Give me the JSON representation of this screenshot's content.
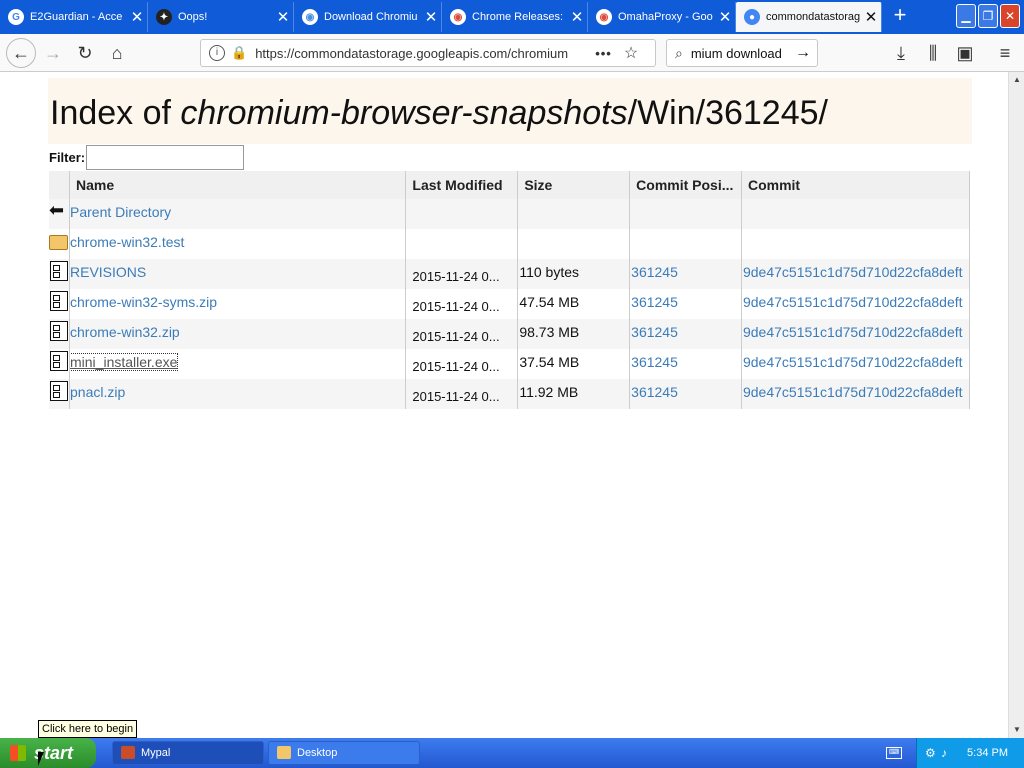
{
  "browser": {
    "tabs": [
      {
        "title": "E2Guardian - Acce",
        "icon": "google-g-icon",
        "color": "#4285f4"
      },
      {
        "title": "Oops!",
        "icon": "sparkle-icon",
        "color": "#222222"
      },
      {
        "title": "Download Chromiu",
        "icon": "chromium-icon",
        "color": "#4a90e2"
      },
      {
        "title": "Chrome Releases:",
        "icon": "chrome-icon",
        "color": "#e04a3a"
      },
      {
        "title": "OmahaProxy - Goo",
        "icon": "chrome-icon",
        "color": "#e04a3a"
      },
      {
        "title": "commondatastorag",
        "icon": "storage-icon",
        "color": "#4285f4",
        "active": true
      }
    ],
    "url": "https://commondatastorage.googleapis.com/chromium",
    "search_value": "mium download"
  },
  "page": {
    "heading_prefix": "Index of ",
    "heading_italic": "chromium-browser-snapshots",
    "heading_suffix": "/Win/361245/",
    "filter_label": "Filter:",
    "filter_value": "",
    "columns": [
      "Name",
      "Last Modified",
      "Size",
      "Commit Posi...",
      "Commit"
    ],
    "rows": [
      {
        "icon": "back",
        "name": "Parent Directory",
        "modified": "",
        "size": "",
        "position": "",
        "commit": ""
      },
      {
        "icon": "folder",
        "name": "chrome-win32.test",
        "modified": "",
        "size": "",
        "position": "",
        "commit": ""
      },
      {
        "icon": "file",
        "name": "REVISIONS",
        "modified": "2015-11-24 0...",
        "size": "110 bytes",
        "position": "361245",
        "commit": "9de47c5151c1d75d710d22cfa8deft"
      },
      {
        "icon": "file",
        "name": "chrome-win32-syms.zip",
        "modified": "2015-11-24 0...",
        "size": "47.54 MB",
        "position": "361245",
        "commit": "9de47c5151c1d75d710d22cfa8deft"
      },
      {
        "icon": "file",
        "name": "chrome-win32.zip",
        "modified": "2015-11-24 0...",
        "size": "98.73 MB",
        "position": "361245",
        "commit": "9de47c5151c1d75d710d22cfa8deft"
      },
      {
        "icon": "file",
        "name": "mini_installer.exe",
        "modified": "2015-11-24 0...",
        "size": "37.54 MB",
        "position": "361245",
        "commit": "9de47c5151c1d75d710d22cfa8deft"
      },
      {
        "icon": "file",
        "name": "pnacl.zip",
        "modified": "2015-11-24 0...",
        "size": "11.92 MB",
        "position": "361245",
        "commit": "9de47c5151c1d75d710d22cfa8deft"
      }
    ]
  },
  "taskbar": {
    "start_label": "start",
    "tooltip": "Click here to begin",
    "buttons": [
      "Mypal",
      "Desktop"
    ],
    "clock": "5:34 PM"
  },
  "colors": {
    "link": "#3b7cb8",
    "tabbar": "#0f5bd8",
    "heading_bg": "#fdf6ec"
  }
}
